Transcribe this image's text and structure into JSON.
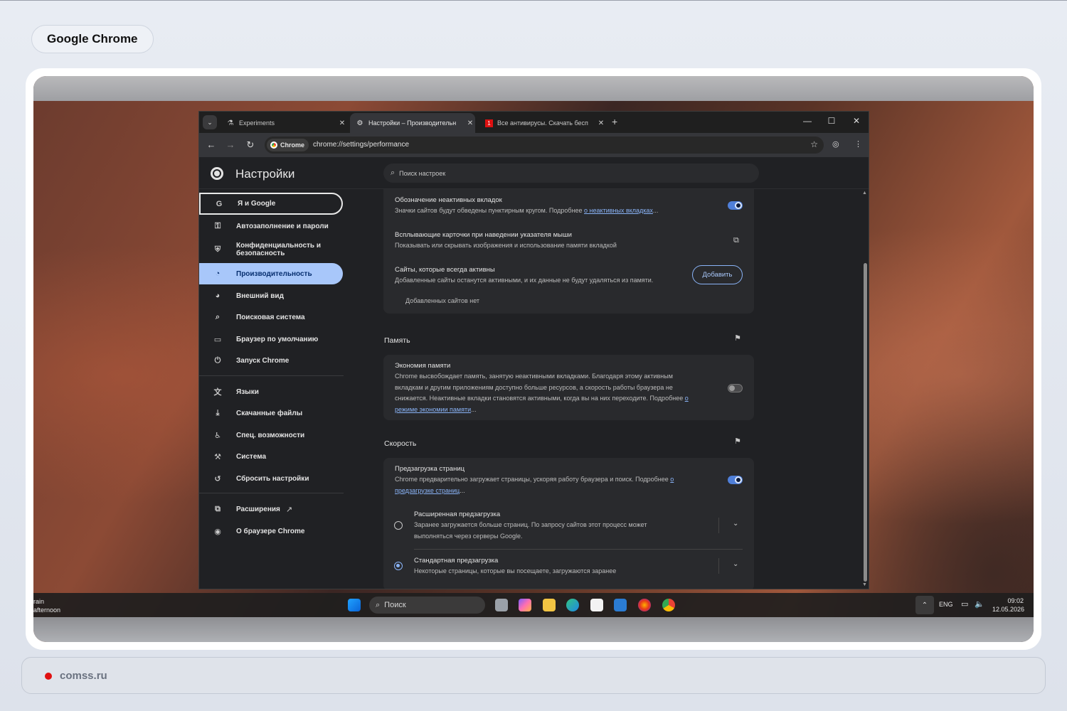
{
  "page_title": "Google Chrome",
  "footer": {
    "site": "comss.ru"
  },
  "browser": {
    "tabs": [
      {
        "label": "Experiments",
        "icon": "flask-icon",
        "active": false
      },
      {
        "label": "Настройки – Производительн",
        "icon": "gear-icon",
        "active": true
      },
      {
        "label": "Все антивирусы. Скачать бесп",
        "icon": "site-favicon-icon",
        "active": false
      }
    ],
    "new_tab": "+",
    "window_controls": {
      "minimize": "—",
      "maximize": "☐",
      "close": "✕"
    },
    "address_chip": "Chrome",
    "url": "chrome://settings/performance"
  },
  "settings": {
    "title": "Настройки",
    "search_placeholder": "Поиск настроек",
    "nav": [
      {
        "label": "Я и Google",
        "icon": "google-icon",
        "state": "focused"
      },
      {
        "label": "Автозаполнение и пароли",
        "icon": "key-icon",
        "state": ""
      },
      {
        "label": "Конфиденциальность и безопасность",
        "icon": "shield-icon",
        "state": ""
      },
      {
        "label": "Производительность",
        "icon": "speedometer-icon",
        "state": "active"
      },
      {
        "label": "Внешний вид",
        "icon": "palette-icon",
        "state": ""
      },
      {
        "label": "Поисковая система",
        "icon": "search-icon",
        "state": ""
      },
      {
        "label": "Браузер по умолчанию",
        "icon": "browser-icon",
        "state": ""
      },
      {
        "label": "Запуск Chrome",
        "icon": "power-icon",
        "state": ""
      },
      {
        "label": "Языки",
        "icon": "translate-icon",
        "state": ""
      },
      {
        "label": "Скачанные файлы",
        "icon": "download-icon",
        "state": ""
      },
      {
        "label": "Спец. возможности",
        "icon": "accessibility-icon",
        "state": ""
      },
      {
        "label": "Система",
        "icon": "wrench-icon",
        "state": ""
      },
      {
        "label": "Сбросить настройки",
        "icon": "reset-icon",
        "state": ""
      },
      {
        "label": "Расширения",
        "icon": "puzzle-icon",
        "state": ""
      },
      {
        "label": "О браузере Chrome",
        "icon": "chrome-icon",
        "state": ""
      }
    ],
    "tabs_card": {
      "inactive_title": "Обозначение неактивных вкладок",
      "inactive_sub": "Значки сайтов будут обведены пунктирным кругом. Подробнее ",
      "inactive_link": "о неактивных вкладках",
      "inactive_ellipsis": "...",
      "inactive_on": true,
      "hover_title": "Всплывающие карточки при наведении указателя мыши",
      "hover_sub": "Показывать или скрывать изображения и использование памяти вкладкой",
      "always_title": "Сайты, которые всегда активны",
      "always_sub": "Добавленные сайты останутся активными, и их данные не будут удаляться из памяти.",
      "add_button": "Добавить",
      "no_sites": "Добавленных сайтов нет"
    },
    "memory": {
      "section": "Память",
      "title": "Экономия памяти",
      "line1": "Chrome высвобождает память, занятую неактивными вкладками. Благодаря этому активным",
      "line2": "вкладкам и другим приложениям доступно больше ресурсов, а скорость работы браузера не",
      "line3": "снижается. Неактивные вкладки становятся активными, когда вы на них переходите. Подробнее ",
      "link1": "о",
      "link2": "режиме экономии памяти",
      "ellipsis": "...",
      "on": false
    },
    "speed": {
      "section": "Скорость",
      "title": "Предзагрузка страниц",
      "line1": "Chrome предварительно загружает страницы, ускоряя работу браузера и поиск. Подробнее ",
      "link1": "о",
      "link2": "предзагрузке страниц",
      "ellipsis": "...",
      "on": true,
      "ext_title": "Расширенная предзагрузка",
      "ext_line1": "Заранее загружается больше страниц. По запросу сайтов этот процесс может",
      "ext_line2": "выполняться через серверы Google.",
      "std_title": "Стандартная предзагрузка",
      "std_sub": "Некоторые страницы, которые вы посещаете, загружаются заранее",
      "selected": "standard"
    }
  },
  "taskbar": {
    "weather_line1": "rain",
    "weather_line2": "afternoon",
    "search_label": "Поиск",
    "lang": "ENG",
    "time": "09:02",
    "date": "12.05.2026",
    "apps": [
      "windows-start-icon",
      "task-view-icon",
      "copilot-icon",
      "file-explorer-icon",
      "edge-icon",
      "store-icon",
      "mail-icon",
      "firefox-icon",
      "chrome-icon"
    ]
  },
  "colors": {
    "accent": "#a8c7fa",
    "link": "#8ab4f8",
    "toggle_on": "#4f7fd9"
  }
}
